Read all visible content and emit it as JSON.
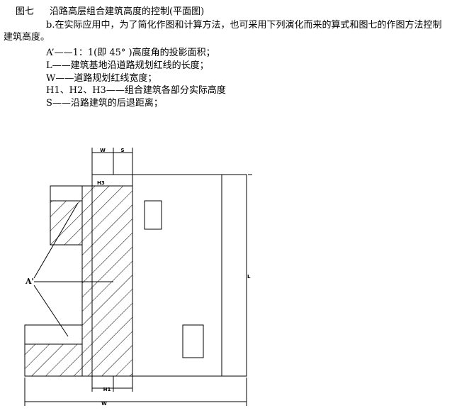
{
  "caption": {
    "figure_no": "图七",
    "title": "沿路高层组合建筑高度的控制(平面图)"
  },
  "paragraph": {
    "line1": "b.在实际应用中，为了简化作图和计算方法，也可采用下列演化而来的算式和图七的作图方法控制",
    "line2": "建筑高度。"
  },
  "definitions": [
    "A’——1：1(即 45°  )高度角的投影面积；",
    "L——建筑基地沿道路规划红线的长度；",
    "W——道路规划红线宽度；",
    "H1、H2、H3——组合建筑各部分实际高度",
    "S——沿路建筑的后退距离；"
  ],
  "diagram_labels": {
    "top_w": "W",
    "top_s": "S",
    "h_mark": "H3",
    "a_prime": "A'",
    "l_mark": "L",
    "bottom_h1": "H1",
    "bottom_w": "W"
  }
}
